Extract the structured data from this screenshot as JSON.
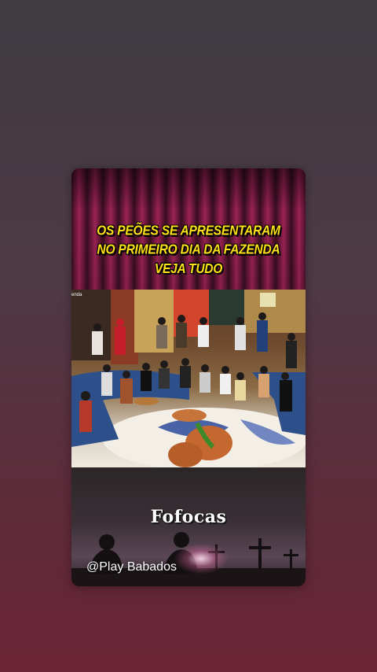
{
  "story": {
    "headline_lines": [
      "OS PEÕES SE APRESENTARAM",
      "NO PRIMEIRO DIA DA FAZENDA",
      "VEJA TUDO"
    ],
    "photo_corner_text": "enda",
    "brand_title": "Fofocas",
    "handle": "@Play Babados"
  },
  "colors": {
    "headline": "#ffe11a",
    "curtain": "#a4265a",
    "background_top": "#3e3b41",
    "background_bottom": "#6a2436"
  },
  "icons": {
    "camera_hint": "crosses-silhouette-icon"
  }
}
